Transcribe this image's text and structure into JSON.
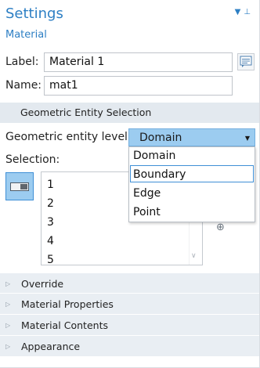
{
  "header": {
    "title": "Settings",
    "subtitle": "Material"
  },
  "label": {
    "text": "Label:",
    "value": "Material 1"
  },
  "name": {
    "text": "Name:",
    "value": "mat1"
  },
  "geometric_section": {
    "title": "Geometric Entity Selection"
  },
  "entity_level": {
    "label": "Geometric entity level:",
    "selected": "Domain",
    "options": [
      "Domain",
      "Boundary",
      "Edge",
      "Point"
    ],
    "highlighted_index": 1
  },
  "selection": {
    "label": "Selection:",
    "items": [
      "1",
      "2",
      "3",
      "4",
      "5"
    ]
  },
  "sections": [
    "Override",
    "Material Properties",
    "Material Contents",
    "Appearance"
  ],
  "colors": {
    "accent": "#2d7fc4",
    "dropdown_bg": "#9cccf0",
    "section_bg": "#e9eef3"
  }
}
